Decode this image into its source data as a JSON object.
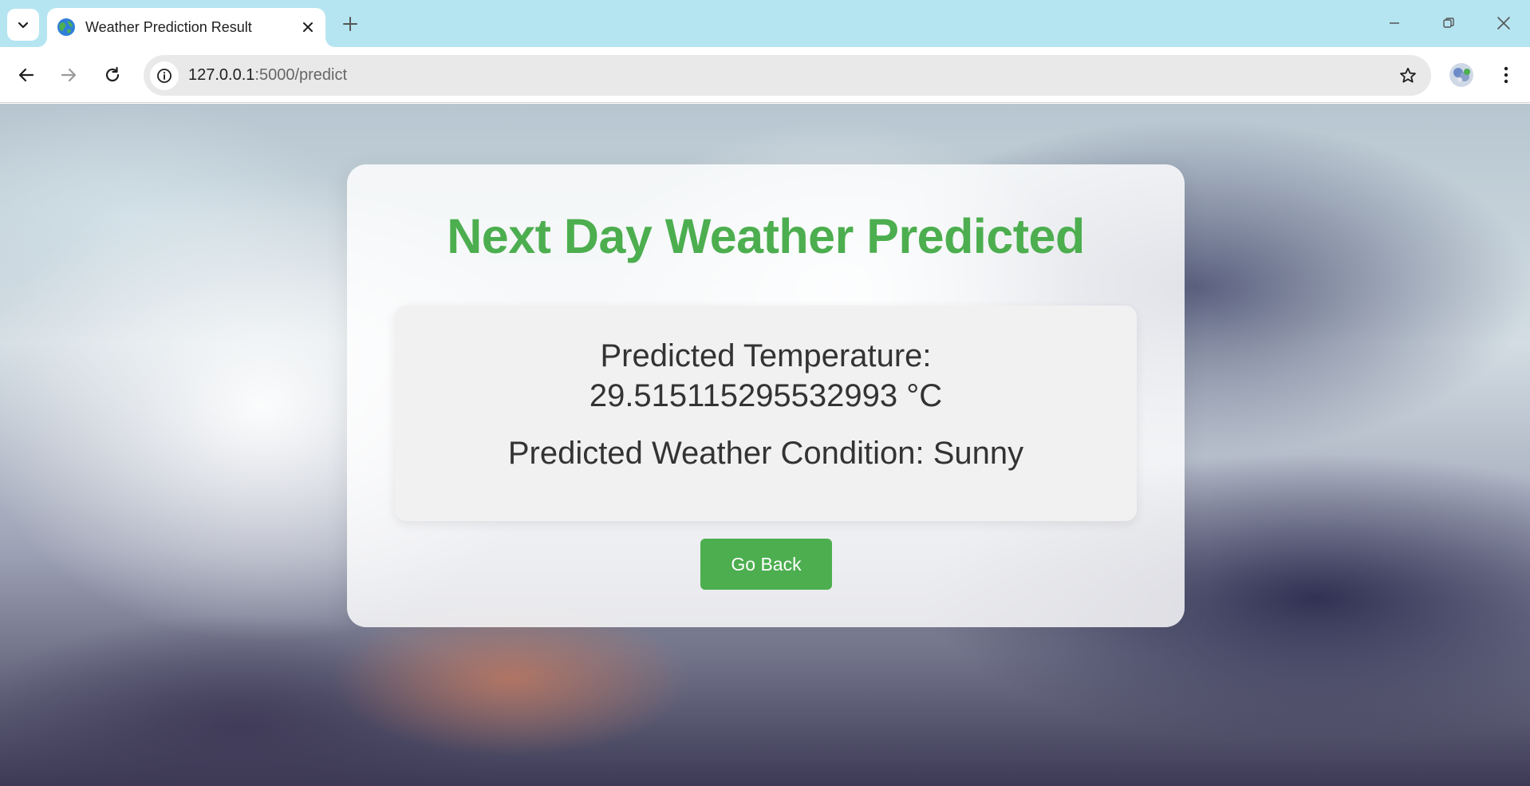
{
  "browser": {
    "tab": {
      "title": "Weather Prediction Result",
      "favicon": "globe-icon"
    },
    "address": {
      "host": "127.0.0.1",
      "path": ":5000/predict"
    },
    "colors": {
      "tabstrip": "#b5e5f1",
      "omnibox": "#e9e9e9"
    }
  },
  "page": {
    "title": "Next Day Weather Predicted",
    "temperature_text": "Predicted Temperature: 29.515115295532993 °C",
    "condition_text": "Predicted Weather Condition: Sunny",
    "go_back_label": "Go Back",
    "colors": {
      "accent": "#4cae4f",
      "text": "#333333"
    }
  }
}
